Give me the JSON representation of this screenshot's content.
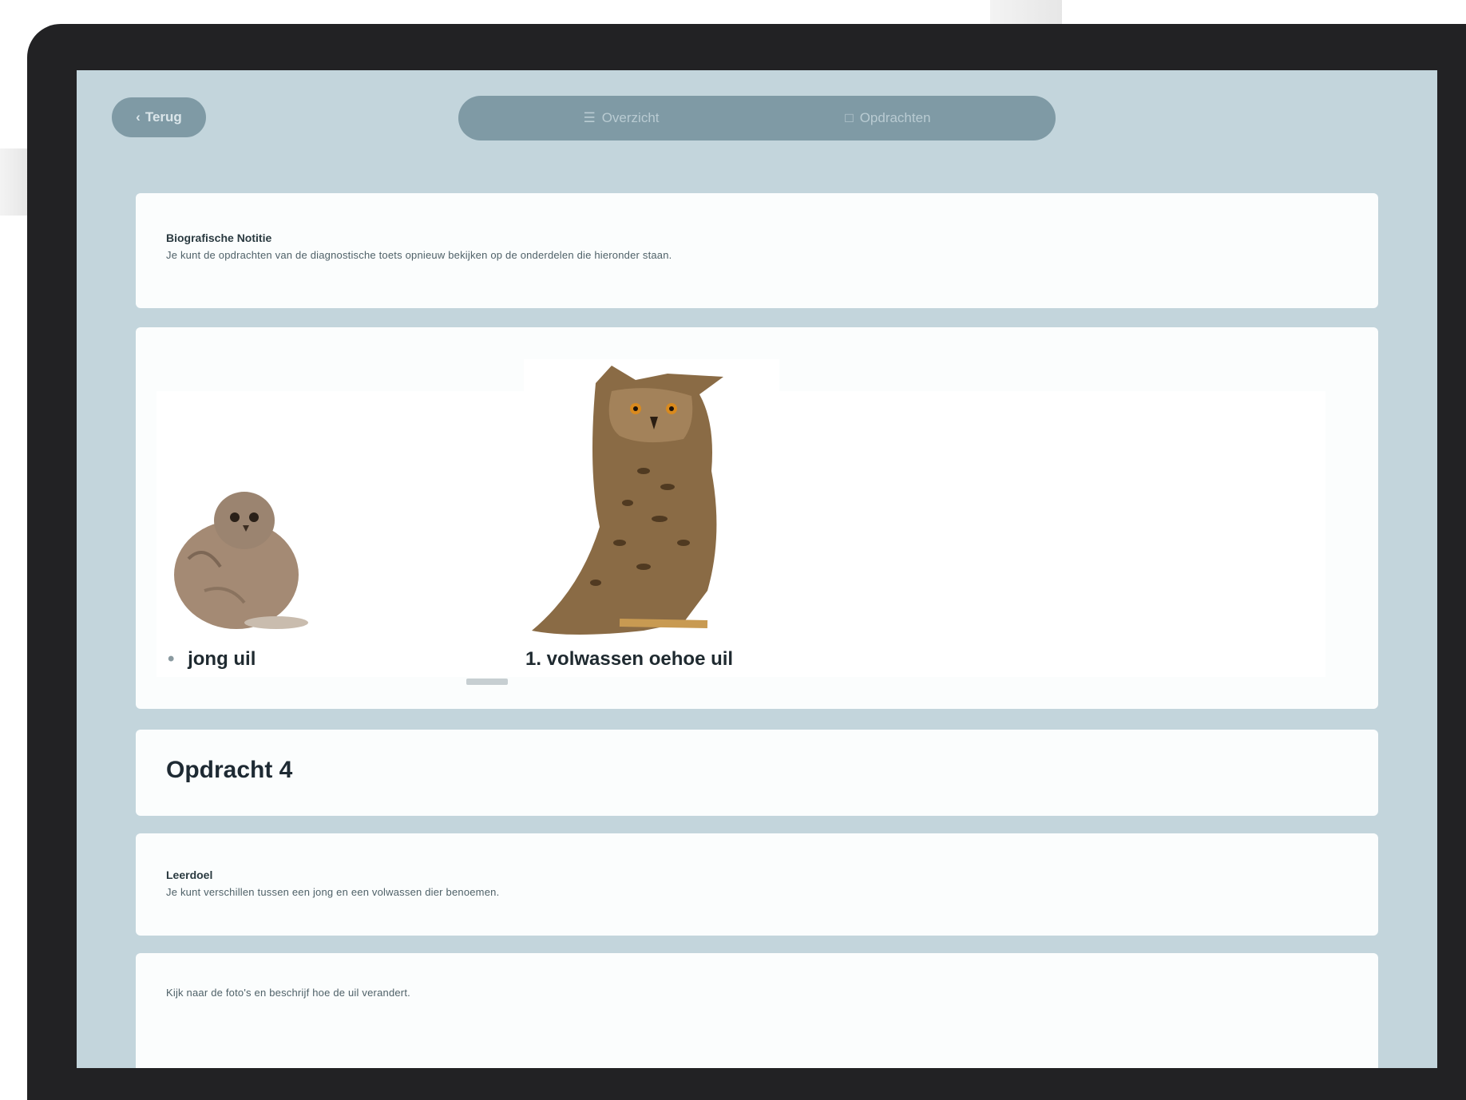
{
  "toolbar": {
    "back_label": "Terug",
    "segments": [
      {
        "label": "Overzicht"
      },
      {
        "label": "Opdrachten"
      }
    ]
  },
  "intro_card": {
    "label": "Biografische Notitie",
    "text": "Je kunt de opdrachten van de diagnostische toets opnieuw bekijken op de onderdelen die hieronder staan."
  },
  "gallery": {
    "items": [
      {
        "caption": "jong uil",
        "icon": "owl-chick-photo"
      },
      {
        "caption": "1. volwassen oehoe uil",
        "icon": "eagle-owl-photo"
      }
    ]
  },
  "assignment": {
    "heading": "Opdracht 4"
  },
  "leerdoel_card": {
    "label": "Leerdoel",
    "text": "Je kunt verschillen tussen een jong en een volwassen dier benoemen."
  },
  "next_card": {
    "text": "Kijk naar de foto's en beschrijf hoe de uil verandert."
  },
  "colors": {
    "screen_bg": "#c3d5dc",
    "pill": "#7f9aa5",
    "card": "#fbfdfd",
    "bezel": "#222224"
  }
}
